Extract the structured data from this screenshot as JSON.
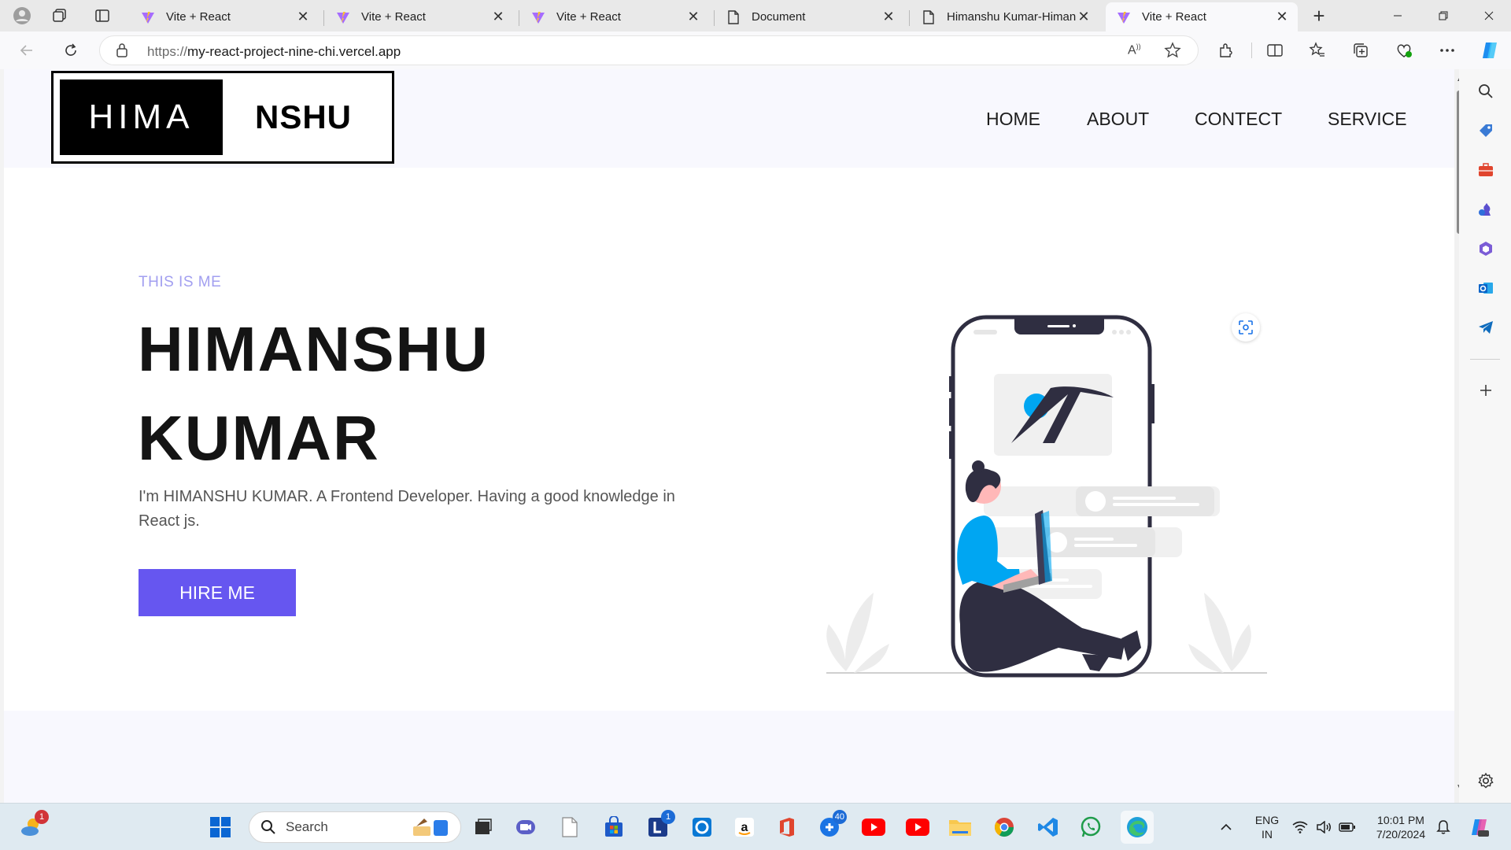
{
  "browser": {
    "tabs": [
      {
        "title": "Vite + React",
        "favicon": "vite-logo-icon",
        "active": false
      },
      {
        "title": "Vite + React",
        "favicon": "vite-logo-icon",
        "active": false
      },
      {
        "title": "Vite + React",
        "favicon": "vite-logo-icon",
        "active": false
      },
      {
        "title": "Document",
        "favicon": "document-icon",
        "active": false
      },
      {
        "title": "Himanshu Kumar-Himan",
        "favicon": "document-icon",
        "active": false
      },
      {
        "title": "Vite + React",
        "favicon": "vite-logo-icon",
        "active": true
      }
    ],
    "close_glyph": "✕",
    "new_tab_glyph": "+",
    "address": {
      "scheme": "https://",
      "host": "my-react-project-nine-chi.vercel.app"
    }
  },
  "site": {
    "logo": {
      "left": "HIMA",
      "right": "NSHU"
    },
    "nav": [
      "HOME",
      "ABOUT",
      "CONTECT",
      "SERVICE"
    ],
    "hero": {
      "eyebrow": "THIS IS ME",
      "name_line1": "HIMANSHU",
      "name_line2": "KUMAR",
      "intro": "I'm HIMANSHU KUMAR. A Frontend Developer. Having a good knowledge in React js.",
      "cta": "HIRE ME"
    }
  },
  "taskbar": {
    "search_placeholder": "Search",
    "weather_badge": "1",
    "teams_badge": "1",
    "app_badge": "40",
    "language": {
      "line1": "ENG",
      "line2": "IN"
    },
    "clock": {
      "time": "10:01 PM",
      "date": "7/20/2024"
    }
  },
  "colors": {
    "accent": "#6656f0",
    "eyebrow": "#a29ff0",
    "illustration_blue": "#00a6f2",
    "illustration_dark": "#2f2e41"
  }
}
